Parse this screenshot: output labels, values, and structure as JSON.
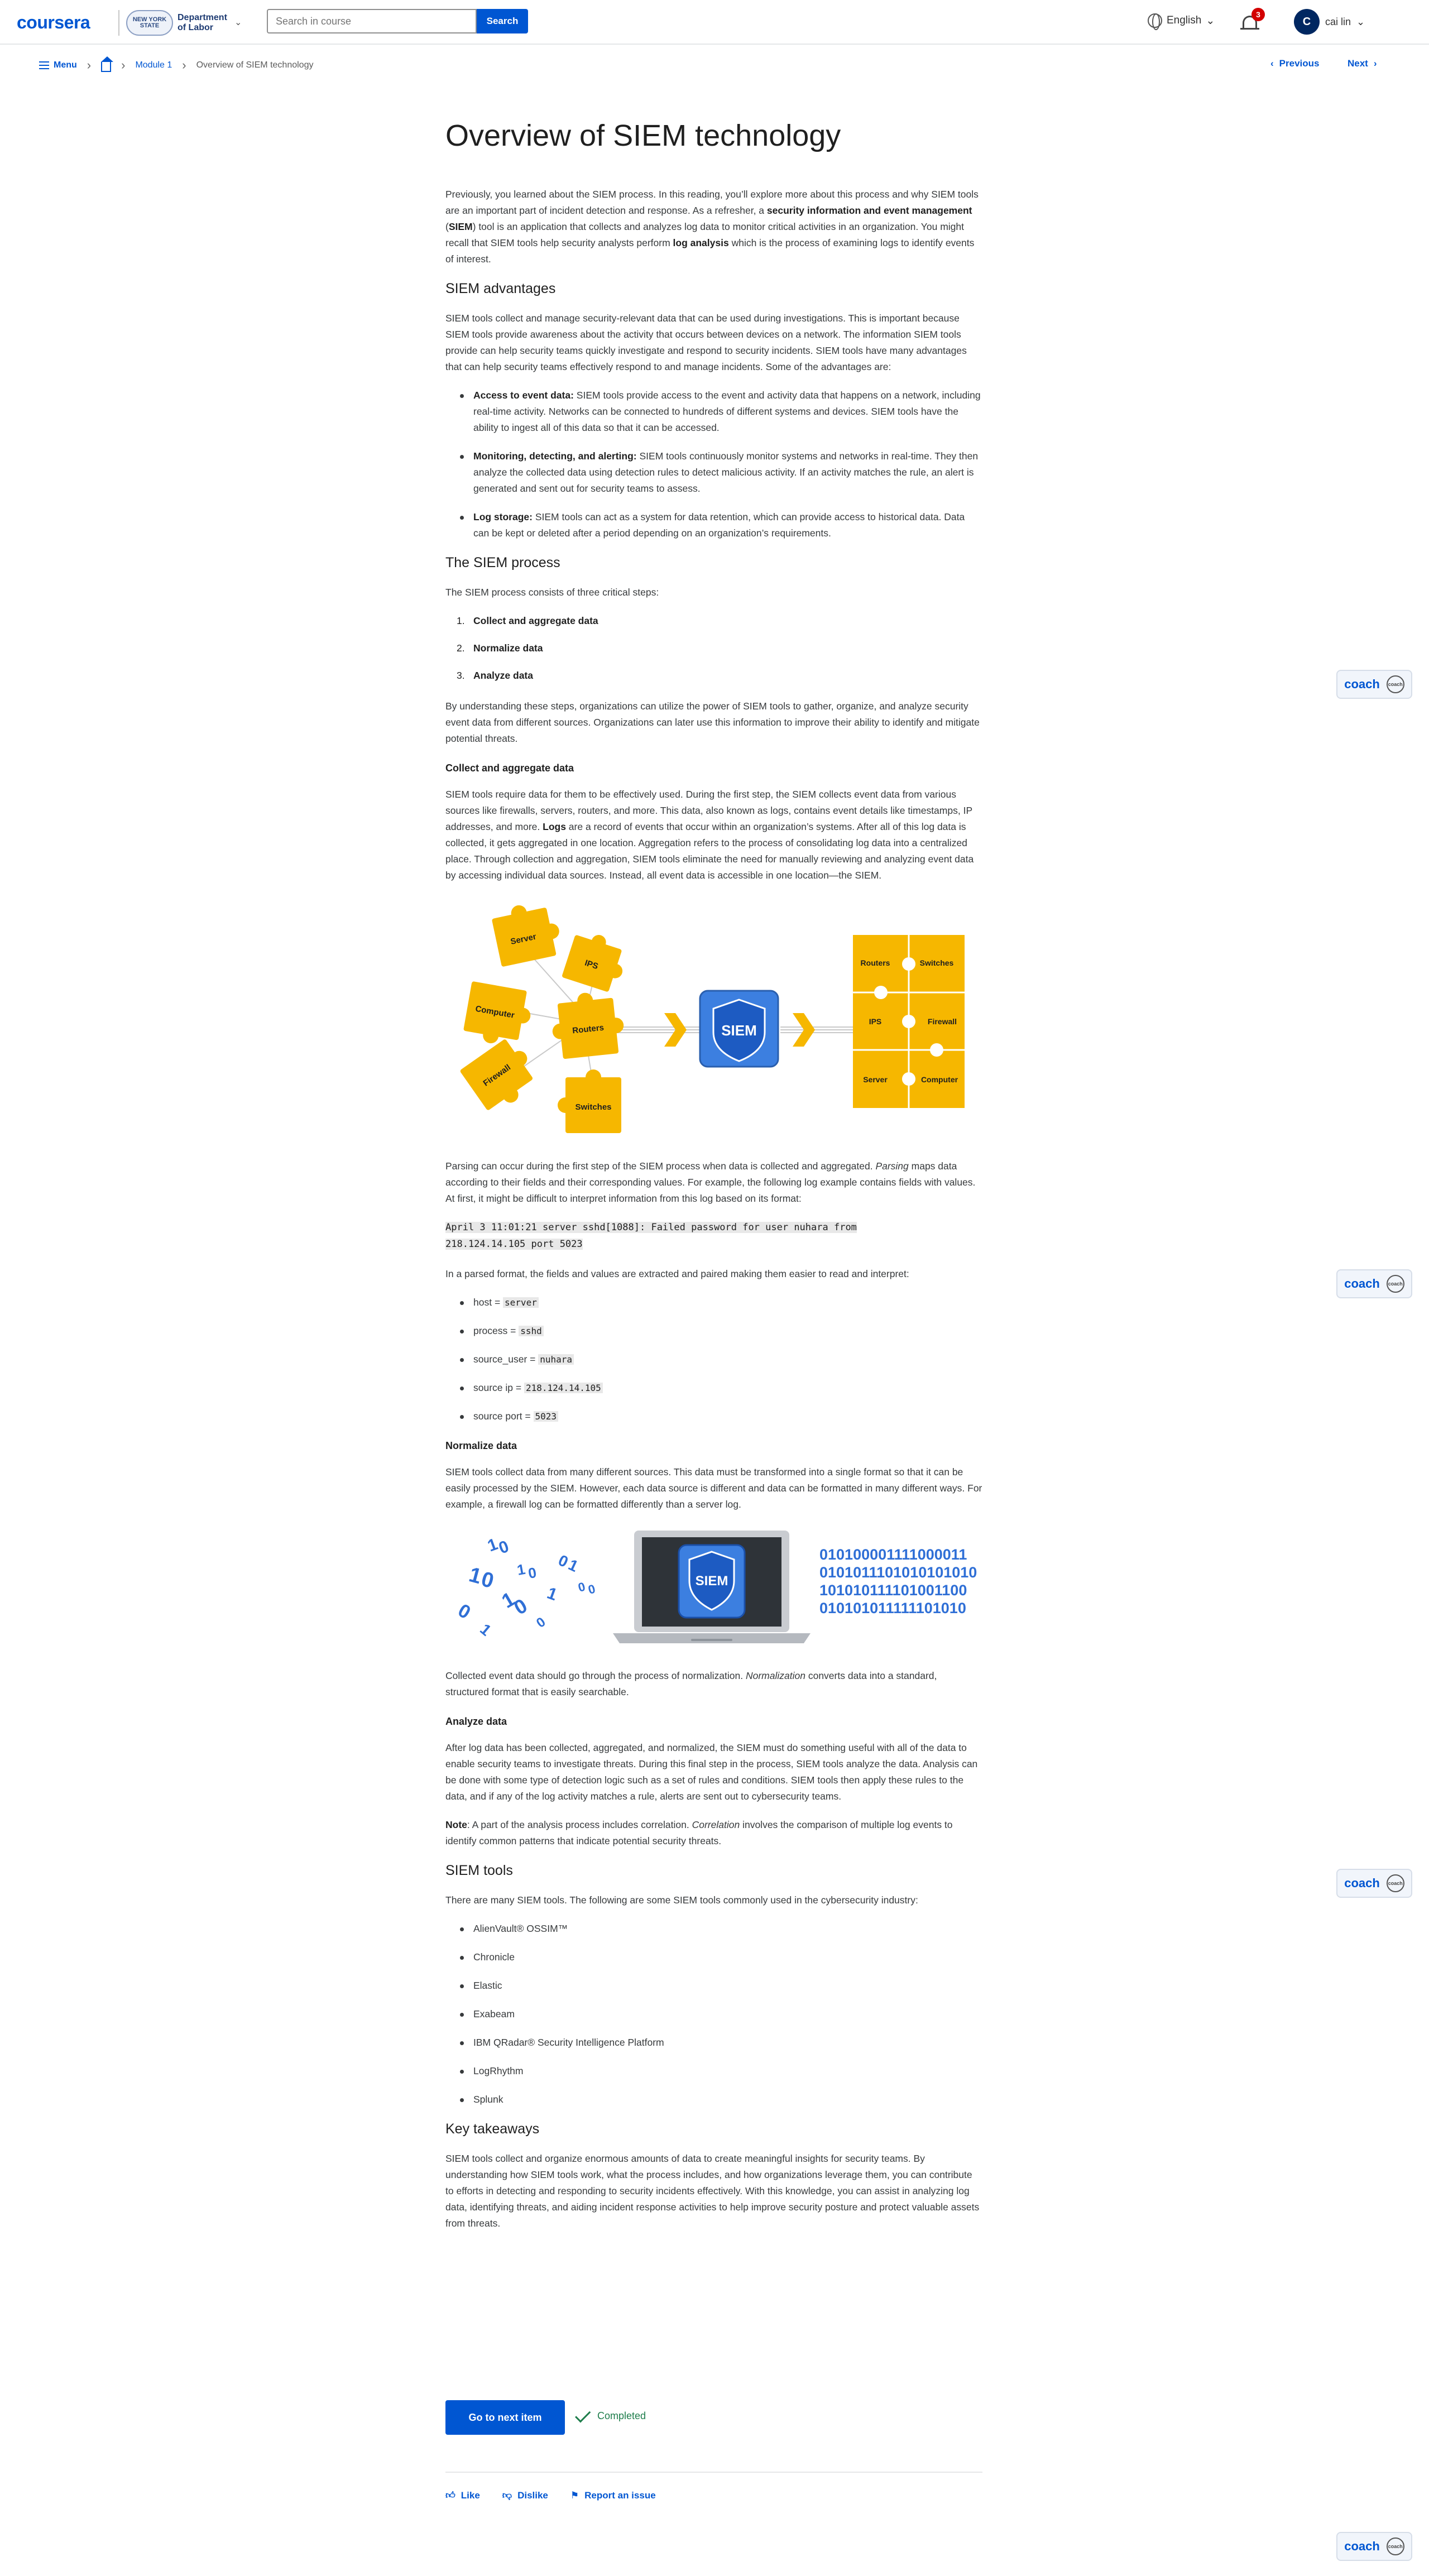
{
  "header": {
    "logo": "coursera",
    "partner_seal": "NEW YORK STATE",
    "partner_name_1": "Department",
    "partner_name_2": "of Labor",
    "search_placeholder": "Search in course",
    "search_button": "Search",
    "language": "English",
    "notification_count": "3",
    "avatar_initial": "C",
    "user_name": "cai lin"
  },
  "nav": {
    "menu": "Menu",
    "module": "Module 1",
    "current": "Overview of SIEM technology",
    "previous": "Previous",
    "next": "Next"
  },
  "article": {
    "title": "Overview of SIEM technology",
    "intro": {
      "t1": "Previously, you learned about the SIEM process. In this reading, you’ll explore more about this process and why SIEM tools are an important part of incident detection and response. As a refresher, a ",
      "b1": "security information and event management",
      "t2": " (",
      "b2": "SIEM",
      "t3": ") tool is an application that collects and analyzes log data to monitor critical activities in an organization. You might recall that SIEM tools help security analysts perform ",
      "b3": "log analysis",
      "t4": " which is the process of examining logs to identify events of interest."
    },
    "advantages_heading": "SIEM advantages",
    "advantages_p": "SIEM tools collect and manage security-relevant data that can be used during investigations. This is important because SIEM tools provide awareness about the activity that occurs between devices on a network. The information SIEM tools provide can help security teams quickly investigate and respond to security incidents. SIEM tools have many advantages that can help security teams effectively respond to and manage incidents. Some of the advantages are:",
    "advantages": [
      {
        "label": "Access to event data:",
        "text": " SIEM tools provide access to the event and activity data that happens on a network, including real-time activity. Networks can be connected to hundreds of different systems and devices. SIEM tools have the ability to ingest all of this data so that it can be accessed."
      },
      {
        "label": "Monitoring, detecting, and alerting:",
        "text": " SIEM tools continuously monitor systems and networks in real-time. They then analyze the collected data using detection rules to detect malicious activity. If an activity matches the rule, an alert is generated and sent out for security teams to assess."
      },
      {
        "label": "Log storage:",
        "text": " SIEM tools can act as a system for data retention, which can provide access to historical data. Data can be kept or deleted after a period depending on an organization’s requirements."
      }
    ],
    "process_heading": "The SIEM process",
    "process_p": "The SIEM process consists of three critical steps:",
    "steps": [
      {
        "n": "1.",
        "label": "Collect and aggregate data"
      },
      {
        "n": "2.",
        "label": "Normalize data"
      },
      {
        "n": "3.",
        "label": "Analyze data"
      }
    ],
    "process_p2": "By understanding these steps, organizations can utilize the power of SIEM tools to gather, organize, and analyze security event data from different sources. Organizations can later use this information to improve their ability to identify and mitigate potential threats.",
    "collect_heading": "Collect and aggregate data",
    "collect_p": {
      "t1": "SIEM tools require data for them to be effectively used. During the first step, the SIEM collects event data from various sources like firewalls, servers, routers, and more. This data, also known as logs, contains event details like timestamps, IP addresses, and more. ",
      "b1": "Logs",
      "t2": " are a record of events that occur within an organization’s systems. After all of this log data is collected, it gets aggregated in one location. Aggregation refers to the process of consolidating log data into a centralized place. Through collection and aggregation, SIEM tools eliminate the need for manually reviewing and analyzing event data by accessing individual data sources. Instead, all event data is accessible in one location—the SIEM."
    },
    "fig1": {
      "pieces": [
        "Server",
        "IPS",
        "Computer",
        "Routers",
        "Firewall",
        "Switches"
      ],
      "center": "SIEM",
      "grid": [
        "Routers",
        "Switches",
        "IPS",
        "Firewall",
        "Server",
        "Computer"
      ]
    },
    "parse_p": {
      "t1": "Parsing can occur during the first step of the SIEM process when data is collected and aggregated. ",
      "i1": "Parsing",
      "t2": " maps data according to their fields and their corresponding values. For example, the following log example contains fields with values. At first, it might be difficult to interpret information from this log based on its format:"
    },
    "log_line1": "April 3 11:01:21 server sshd[1088]: Failed password for user nuhara from",
    "log_line2": "218.124.14.105 port 5023",
    "parsed_p": "In a parsed format, the fields and values are extracted and paired making them easier to read and interpret:",
    "parsed": [
      {
        "field": "host = ",
        "value": "server"
      },
      {
        "field": "process = ",
        "value": "sshd"
      },
      {
        "field": "source_user = ",
        "value": "nuhara"
      },
      {
        "field": "source ip = ",
        "value": "218.124.14.105"
      },
      {
        "field": "source port = ",
        "value": "5023"
      }
    ],
    "normalize_heading": "Normalize data",
    "normalize_p": "SIEM tools collect data from many different sources. This data must be transformed into a single format so that it can be easily processed by the SIEM. However, each data source is different and data can be formatted in many different ways. For example, a firewall log can be formatted differently than a server log.",
    "fig2": {
      "center": "SIEM",
      "binary": [
        "010100001111000011",
        "0101011101010101010",
        "101010111101001100",
        "010101011111101010"
      ],
      "scatter_digits": [
        "1",
        "0",
        "1",
        "0",
        "0",
        "1",
        "0",
        "1",
        "0",
        "1",
        "0",
        "1",
        "0",
        "0",
        "1",
        "0"
      ]
    },
    "normalize_p2": {
      "t1": "Collected event data should go through the process of normalization. ",
      "i1": "Normalization",
      "t2": " converts data into a standard, structured format that is easily searchable."
    },
    "analyze_heading": "Analyze data",
    "analyze_p": "After log data has been collected, aggregated, and normalized, the SIEM must do something useful with all of the data to enable security teams to investigate threats. During this final step in the process, SIEM tools analyze the data. Analysis can be done with some type of detection logic such as a set of rules and conditions. SIEM tools then apply these rules to the data, and if any of the log activity matches a rule, alerts are sent out to cybersecurity teams.",
    "note_p": {
      "b1": "Note",
      "t1": ": A part of the analysis process includes correlation. ",
      "i1": "Correlation",
      "t2": " involves the comparison of multiple log events to identify common patterns that indicate potential security threats."
    },
    "tools_heading": "SIEM tools",
    "tools_p": "There are many SIEM tools. The following are some SIEM tools commonly used in the cybersecurity industry:",
    "tools": [
      "AlienVault® OSSIM™",
      "Chronicle",
      "Elastic",
      "Exabeam",
      "IBM QRadar® Security Intelligence Platform",
      "LogRhythm",
      "Splunk"
    ],
    "takeaways_heading": "Key takeaways",
    "takeaways_p": "SIEM tools collect and organize enormous amounts of data to create meaningful insights for security teams. By understanding how SIEM tools work, what the process includes, and how organizations leverage them, you can contribute to efforts in detecting and responding to security incidents effectively. With this knowledge, you can assist in analyzing log data, identifying threats, and aiding incident response activities to help improve security posture and protect valuable assets from threats."
  },
  "footer": {
    "next_item": "Go to next item",
    "completed": "Completed",
    "like": "Like",
    "dislike": "Dislike",
    "report": "Report an issue"
  },
  "coach": {
    "label": "coach",
    "icon_text": "coach"
  },
  "colors": {
    "brand": "#0056d2",
    "puzzle": "#f6b700",
    "shield": "#2f7de1",
    "completed": "#1e7d4b"
  }
}
